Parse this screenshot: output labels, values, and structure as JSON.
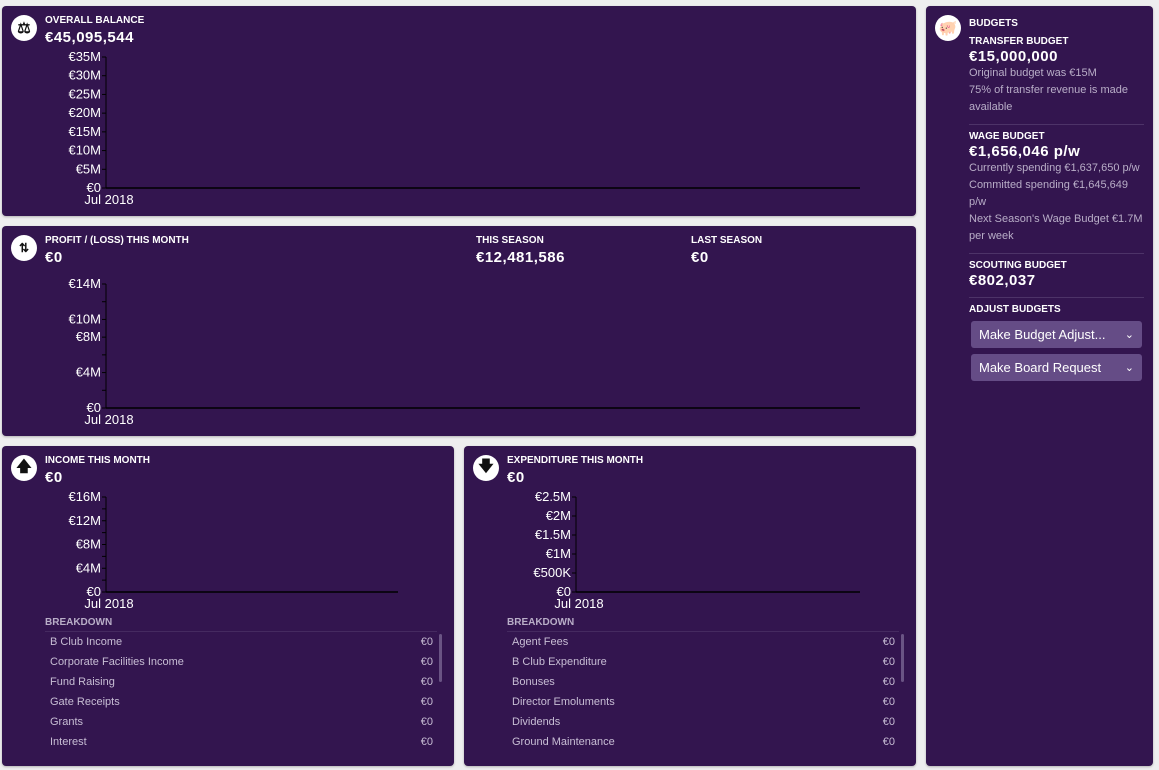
{
  "overall": {
    "title": "OVERALL BALANCE",
    "value": "€45,095,544",
    "icon": "balance-scale-icon"
  },
  "profit": {
    "title": "PROFIT / (LOSS) THIS MONTH",
    "value": "€0",
    "this_season_label": "THIS SEASON",
    "this_season_value": "€12,481,586",
    "last_season_label": "LAST SEASON",
    "last_season_value": "€0",
    "icon": "profit-loss-arrows-icon"
  },
  "income": {
    "title": "INCOME THIS MONTH",
    "value": "€0",
    "icon": "arrow-up-icon",
    "breakdown_label": "BREAKDOWN",
    "rows": [
      {
        "label": "B Club Income",
        "value": "€0"
      },
      {
        "label": "Corporate Facilities Income",
        "value": "€0"
      },
      {
        "label": "Fund Raising",
        "value": "€0"
      },
      {
        "label": "Gate Receipts",
        "value": "€0"
      },
      {
        "label": "Grants",
        "value": "€0"
      },
      {
        "label": "Interest",
        "value": "€0"
      }
    ]
  },
  "expenditure": {
    "title": "EXPENDITURE THIS MONTH",
    "value": "€0",
    "icon": "arrow-down-icon",
    "breakdown_label": "BREAKDOWN",
    "rows": [
      {
        "label": "Agent Fees",
        "value": "€0"
      },
      {
        "label": "B Club Expenditure",
        "value": "€0"
      },
      {
        "label": "Bonuses",
        "value": "€0"
      },
      {
        "label": "Director Emoluments",
        "value": "€0"
      },
      {
        "label": "Dividends",
        "value": "€0"
      },
      {
        "label": "Ground Maintenance",
        "value": "€0"
      }
    ]
  },
  "budgets": {
    "title": "BUDGETS",
    "icon": "piggy-bank-icon",
    "transfer_label": "TRANSFER BUDGET",
    "transfer_value": "€15,000,000",
    "transfer_note1": "Original budget was €15M",
    "transfer_note2": "75% of transfer revenue is made available",
    "wage_label": "WAGE BUDGET",
    "wage_value": "€1,656,046 p/w",
    "wage_note1": "Currently spending €1,637,650 p/w",
    "wage_note2": "Committed spending €1,645,649 p/w",
    "wage_note3": "Next Season's Wage Budget €1.7M per week",
    "scouting_label": "SCOUTING BUDGET",
    "scouting_value": "€802,037",
    "adjust_label": "ADJUST BUDGETS",
    "dropdown1": "Make Budget Adjust...",
    "dropdown2": "Make Board Request"
  },
  "chart_data": [
    {
      "id": "overall",
      "type": "line",
      "x": [
        "Jul 2018"
      ],
      "xtick_labels": [
        "Jul 2018"
      ],
      "ylim": [
        0,
        35000000
      ],
      "yticks": [
        0,
        5000000,
        10000000,
        15000000,
        20000000,
        25000000,
        30000000,
        35000000
      ],
      "ytick_labels": [
        "€0",
        "€5M",
        "€10M",
        "€15M",
        "€20M",
        "€25M",
        "€30M",
        "€35M"
      ],
      "series": []
    },
    {
      "id": "profit",
      "type": "line",
      "x": [
        "Jul 2018"
      ],
      "xtick_labels": [
        "Jul 2018"
      ],
      "ylim": [
        0,
        14000000
      ],
      "yticks": [
        0,
        2000000,
        4000000,
        6000000,
        8000000,
        10000000,
        12000000,
        14000000
      ],
      "ytick_labels": [
        "€0",
        "",
        "€4M",
        "",
        "€8M",
        "€10M",
        "",
        "€14M"
      ],
      "series": []
    },
    {
      "id": "income",
      "type": "bar",
      "x": [
        "Jul 2018"
      ],
      "xtick_labels": [
        "Jul 2018"
      ],
      "ylim": [
        0,
        16000000
      ],
      "yticks": [
        0,
        2000000,
        4000000,
        6000000,
        8000000,
        10000000,
        12000000,
        14000000,
        16000000
      ],
      "ytick_labels": [
        "€0",
        "",
        "€4M",
        "",
        "€8M",
        "",
        "€12M",
        "",
        "€16M"
      ],
      "series": []
    },
    {
      "id": "expenditure",
      "type": "bar",
      "x": [
        "Jul 2018"
      ],
      "xtick_labels": [
        "Jul 2018"
      ],
      "ylim": [
        0,
        2500000
      ],
      "yticks": [
        0,
        500000,
        1000000,
        1500000,
        2000000,
        2500000
      ],
      "ytick_labels": [
        "€0",
        "€500K",
        "€1M",
        "€1.5M",
        "€2M",
        "€2.5M"
      ],
      "series": []
    }
  ]
}
